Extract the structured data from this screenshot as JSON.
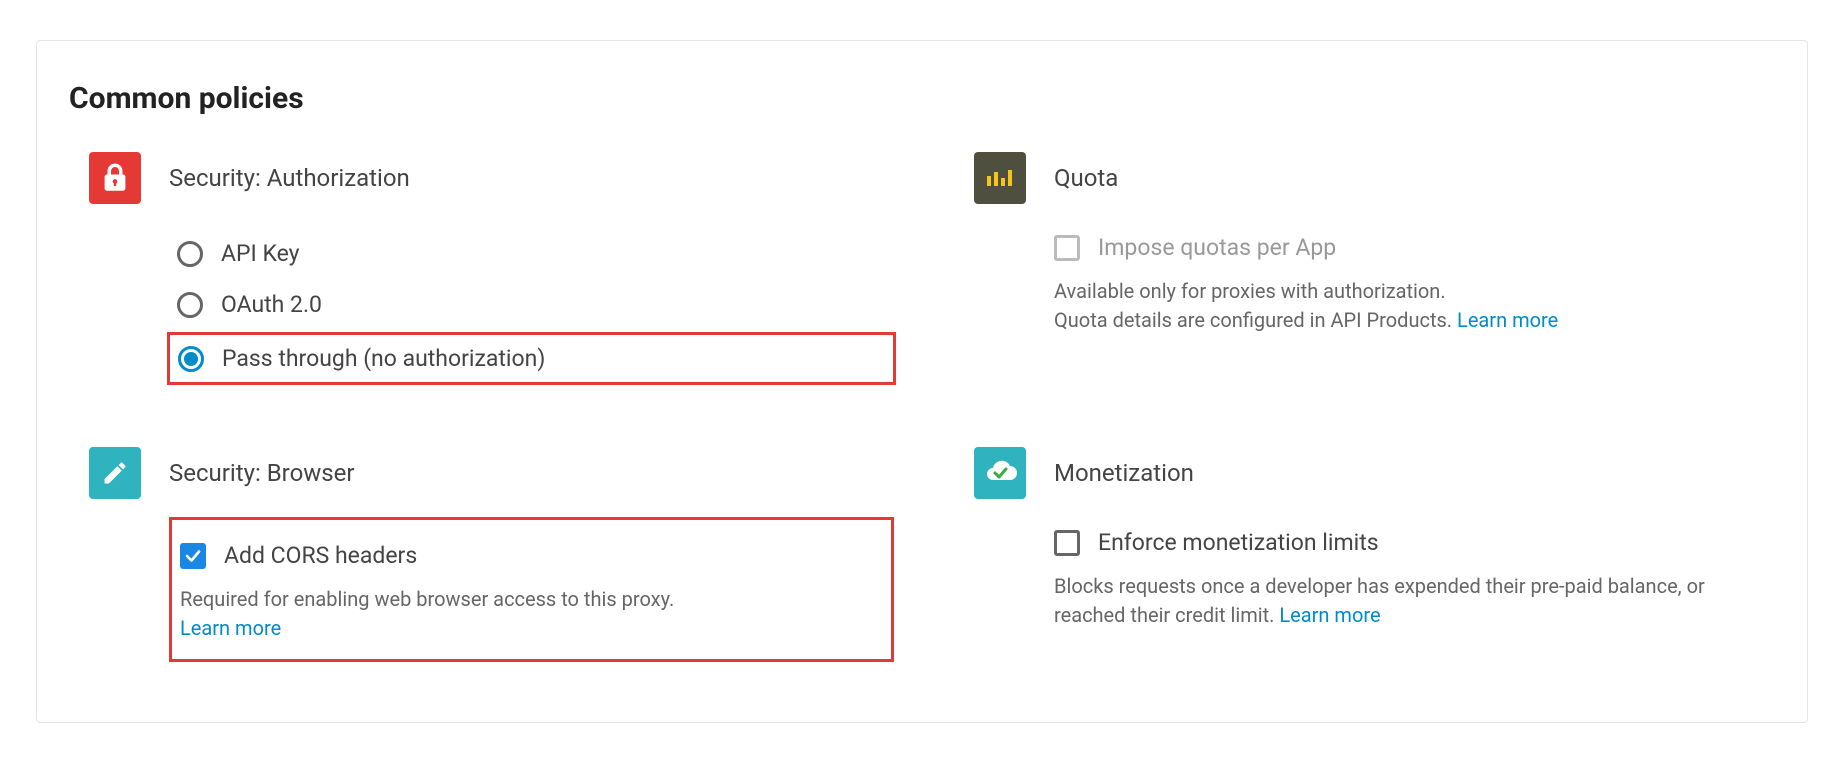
{
  "section_title": "Common policies",
  "policies": {
    "security_auth": {
      "title": "Security: Authorization",
      "options": {
        "api_key": "API Key",
        "oauth": "OAuth 2.0",
        "pass_through": "Pass through (no authorization)"
      }
    },
    "quota": {
      "title": "Quota",
      "checkbox_label": "Impose quotas per App",
      "help1": "Available only for proxies with authorization.",
      "help2": "Quota details are configured in API Products. ",
      "learn_more": "Learn more"
    },
    "security_browser": {
      "title": "Security: Browser",
      "checkbox_label": "Add CORS headers",
      "help": "Required for enabling web browser access to this proxy.",
      "learn_more": "Learn more"
    },
    "monetization": {
      "title": "Monetization",
      "checkbox_label": "Enforce monetization limits",
      "help": "Blocks requests once a developer has expended their pre-paid balance, or reached their credit limit. ",
      "learn_more": "Learn more"
    }
  }
}
